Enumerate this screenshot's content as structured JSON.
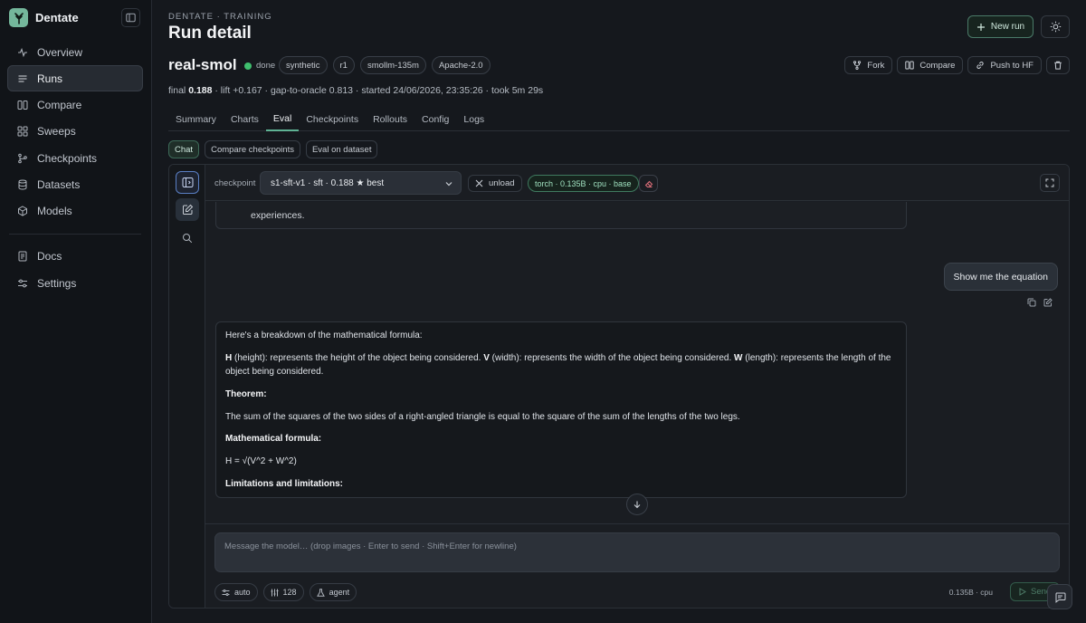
{
  "app": {
    "name": "Dentate"
  },
  "sidebar": {
    "items": [
      {
        "label": "Overview",
        "icon": "activity-icon"
      },
      {
        "label": "Runs",
        "icon": "list-icon"
      },
      {
        "label": "Compare",
        "icon": "columns-icon"
      },
      {
        "label": "Sweeps",
        "icon": "grid-icon"
      },
      {
        "label": "Checkpoints",
        "icon": "branch-icon"
      },
      {
        "label": "Datasets",
        "icon": "database-icon"
      },
      {
        "label": "Models",
        "icon": "box-icon"
      }
    ],
    "footer": [
      {
        "label": "Docs",
        "icon": "doc-icon"
      },
      {
        "label": "Settings",
        "icon": "sliders-icon"
      }
    ],
    "active": "Runs"
  },
  "header": {
    "breadcrumb": "DENTATE · TRAINING",
    "title": "Run detail",
    "new_run_label": "New run"
  },
  "run": {
    "name": "real-smol",
    "status": "done",
    "tags": [
      "synthetic",
      "r1",
      "smollm-135m",
      "Apache-2.0"
    ],
    "actions": {
      "fork": "Fork",
      "compare": "Compare",
      "push": "Push to HF"
    },
    "summary": {
      "final_label": "final",
      "final_value": "0.188",
      "rest": "· lift +0.167 · gap-to-oracle 0.813 · started 24/06/2026, 23:35:26 · took 5m 29s"
    }
  },
  "tabs": [
    "Summary",
    "Charts",
    "Eval",
    "Checkpoints",
    "Rollouts",
    "Config",
    "Logs"
  ],
  "active_tab": "Eval",
  "subtabs": [
    "Chat",
    "Compare checkpoints",
    "Eval on dataset"
  ],
  "active_subtab": "Chat",
  "chat": {
    "checkpoint_label": "checkpoint",
    "checkpoint_value": "s1-sft-v1 · sft · 0.188 ★ best",
    "unload_label": "unload",
    "runtime_badge": "torch · 0.135B · cpu · base",
    "prev_message_tail": "experiences.",
    "user_message": "Show me the equation",
    "reply": {
      "intro": "Here's a breakdown of the mathematical formula:",
      "vars": [
        {
          "sym": "H",
          "text": " (height): represents the height of the object being considered. "
        },
        {
          "sym": "V",
          "text": " (width): represents the width of the object being considered. "
        },
        {
          "sym": "W",
          "text": " (length): represents the length of the object being considered."
        }
      ],
      "theorem_heading": "Theorem:",
      "theorem_text": "The sum of the squares of the two sides of a right-angled triangle is equal to the square of the sum of the lengths of the two legs.",
      "formula_heading": "Mathematical formula:",
      "formula": "H = √(V^2 + W^2)",
      "limits_heading": "Limitations and limitations:"
    },
    "composer_placeholder": "Message the model… (drop images · Enter to send · Shift+Enter for newline)",
    "options": {
      "mode": "auto",
      "tokens": "128",
      "agent": "agent"
    },
    "meta": "0.135B · cpu",
    "send_label": "Send"
  },
  "colors": {
    "accent": "#5fb394",
    "status_done": "#3fbf6e",
    "background": "#15181d"
  }
}
